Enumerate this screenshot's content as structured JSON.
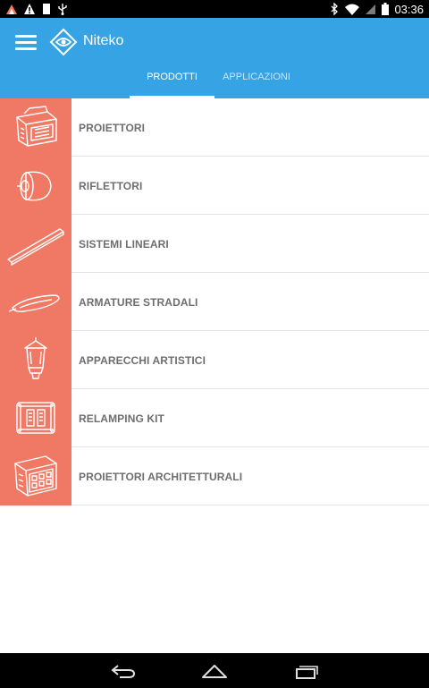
{
  "app": {
    "title": "Niteko"
  },
  "status": {
    "time": "03:36"
  },
  "tabs": [
    {
      "label": "PRODOTTI",
      "active": true
    },
    {
      "label": "APPLICAZIONI",
      "active": false
    }
  ],
  "products": [
    {
      "label": "PROIETTORI",
      "icon": "floodlight-icon"
    },
    {
      "label": "RIFLETTORI",
      "icon": "reflector-icon"
    },
    {
      "label": "SISTEMI LINEARI",
      "icon": "linear-light-icon"
    },
    {
      "label": "ARMATURE STRADALI",
      "icon": "street-light-icon"
    },
    {
      "label": "APPARECCHI ARTISTICI",
      "icon": "lantern-icon"
    },
    {
      "label": "RELAMPING KIT",
      "icon": "relamping-kit-icon"
    },
    {
      "label": "PROIETTORI ARCHITETTURALI",
      "icon": "architectural-floodlight-icon"
    }
  ],
  "colors": {
    "primary": "#36a3e5",
    "thumb_bg": "#f07965",
    "label_text": "#6e6e6e",
    "divider": "#e4e4e4"
  }
}
